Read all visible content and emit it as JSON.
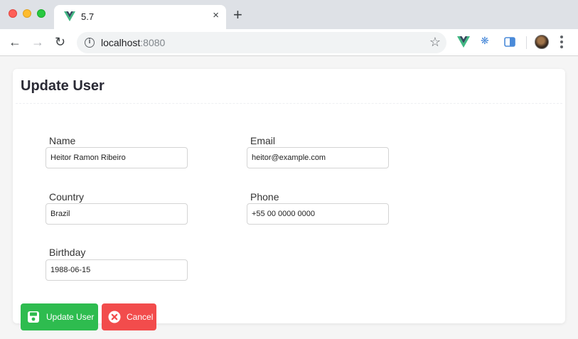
{
  "browser": {
    "tab_title": "5.7",
    "tab_close": "×",
    "new_tab": "+",
    "url_host": "localhost",
    "url_port": ":8080"
  },
  "page": {
    "title": "Update User",
    "fields": {
      "name": {
        "label": "Name",
        "value": "Heitor Ramon Ribeiro"
      },
      "email": {
        "label": "Email",
        "value": "heitor@example.com"
      },
      "country": {
        "label": "Country",
        "value": "Brazil"
      },
      "phone": {
        "label": "Phone",
        "value": "+55 00 0000 0000"
      },
      "birthday": {
        "label": "Birthday",
        "value": "1988-06-15"
      }
    },
    "buttons": {
      "update": "Update User",
      "cancel": "Cancel"
    }
  },
  "colors": {
    "update_button": "#2ebc4f",
    "cancel_button": "#f24c4c",
    "vue_green": "#41b883",
    "vue_dark": "#35495e"
  },
  "icons": {
    "update_button": "floppy-disk-icon",
    "cancel_button": "close-circle-icon"
  }
}
